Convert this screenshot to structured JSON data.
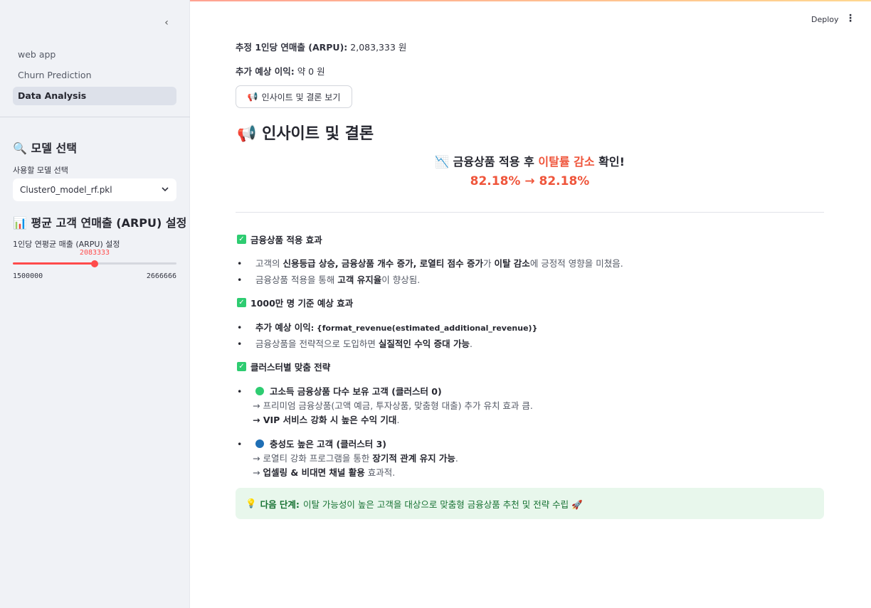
{
  "sidebar": {
    "collapse_icon": "‹",
    "nav": [
      {
        "label": "web app",
        "active": false
      },
      {
        "label": "Churn Prediction",
        "active": false
      },
      {
        "label": "Data Analysis",
        "active": true
      }
    ],
    "model_heading_icon": "🔍",
    "model_heading": "모델 선택",
    "model_label": "사용할 모델 선택",
    "model_selected": "Cluster0_model_rf.pkl",
    "arpu_heading_icon": "📊",
    "arpu_heading": "평균 고객 연매출 (ARPU) 설정",
    "slider_label": "1인당 연평균 매출 (ARPU) 설정",
    "slider_value": "2083333",
    "slider_min": "1500000",
    "slider_max": "2666666",
    "slider_fraction": 0.5
  },
  "header": {
    "deploy_label": "Deploy",
    "menu_icon": "⋮"
  },
  "main": {
    "arpu_label": "추정 1인당 연매출 (ARPU):",
    "arpu_value": "2,083,333 원",
    "profit_label": "추가 예상 이익:",
    "profit_value": "약 0 원",
    "button_icon": "📢",
    "button_label": "인사이트 및 결론 보기",
    "title_icon": "📢",
    "title": "인사이트 및 결론",
    "result_icon": "📉",
    "result_prefix": "금융상품 적용 후",
    "result_highlight": "이탈률 감소",
    "result_suffix": "확인!",
    "rate_text": "82.18% → 82.18%",
    "section1": {
      "title": "금융상품 적용 효과",
      "b1_pre": "고객의",
      "b1_bold1": "신용등급 상승, 금융상품 개수 증가, 로열티 점수 증가",
      "b1_mid": "가",
      "b1_bold2": "이탈 감소",
      "b1_post": "에 긍정적 영향을 미쳤음.",
      "b2_pre": "금융상품 적용을 통해",
      "b2_bold": "고객 유지율",
      "b2_post": "이 향상됨."
    },
    "section2": {
      "title": "1000만 명 기준 예상 효과",
      "b1_bold": "추가 예상 이익",
      "b1_post": ": {format_revenue(estimated_additional_revenue)}",
      "b2_pre": "금융상품을 전략적으로 도입하면",
      "b2_bold": "실질적인 수익 증대 가능",
      "b2_post": "."
    },
    "section3": {
      "title": "클러스터별 맞춤 전략",
      "c1_color": "#2ecc71",
      "c1_title": "고소득 금융상품 다수 보유 고객 (클러스터 0)",
      "c1_line1": "→ 프리미엄 금융상품(고액 예금, 투자상품, 맞춤형 대출) 추가 유치 효과 큼.",
      "c1_line2_bold": "→ VIP 서비스 강화 시 높은 수익 기대",
      "c1_line2_post": ".",
      "c2_color": "#1f6fb5",
      "c2_title": "충성도 높은 고객 (클러스터 3)",
      "c2_line1_pre": "→ 로열티 강화 프로그램을 통한",
      "c2_line1_bold": "장기적 관계 유지 가능",
      "c2_line1_post": ".",
      "c2_line2_pre": "→",
      "c2_line2_bold": "업셀링 & 비대면 채널 활용",
      "c2_line2_post": "효과적."
    },
    "info": {
      "icon": "💡",
      "label": "다음 단계:",
      "text": "이탈 가능성이 높은 고객을 대상으로 맞춤형 금융상품 추천 및 전략 수립 🚀"
    }
  }
}
